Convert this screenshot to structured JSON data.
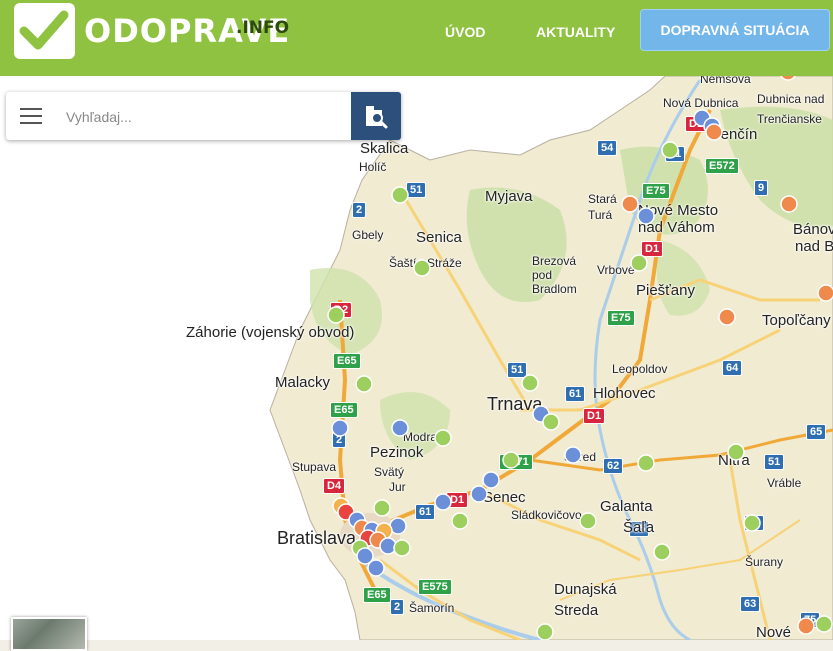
{
  "header": {
    "logo_text": "ODOPRAVE",
    "logo_suffix": ".INFO",
    "nav": [
      {
        "label": "ÚVOD"
      },
      {
        "label": "AKTUALITY"
      },
      {
        "label": "DOPRAVNÁ SITUÁCIA"
      }
    ]
  },
  "search": {
    "placeholder": "Vyhľadaj..."
  },
  "colors": {
    "brand_green": "#8fc241",
    "cta_blue": "#73b6ea",
    "search_button": "#2c4f7c",
    "marker_green": "#9ccf5e",
    "marker_blue": "#6b8fd8",
    "marker_orange": "#ef8a4c",
    "marker_red": "#e9433f",
    "marker_yellow": "#f3b24d"
  },
  "icons": {
    "logo": "check-icon",
    "menu": "hamburger-menu-icon",
    "search": "map-search-icon"
  },
  "map": {
    "places": [
      {
        "name": "Nemšová"
      },
      {
        "name": "Nová Dubnica"
      },
      {
        "name": "Dubnica nad"
      },
      {
        "name": "Trenčín"
      },
      {
        "name": "Trenčianske"
      },
      {
        "name": "Skalica"
      },
      {
        "name": "Holíč"
      },
      {
        "name": "Myjava"
      },
      {
        "name": "Stará"
      },
      {
        "name": "Turá"
      },
      {
        "name": "Nové Mesto"
      },
      {
        "name": "nad Váhom"
      },
      {
        "name": "Bánov"
      },
      {
        "name": "nad B"
      },
      {
        "name": "Senica"
      },
      {
        "name": "Gbely"
      },
      {
        "name": "Šaštín-Stráže"
      },
      {
        "name": "Brezová"
      },
      {
        "name": "pod"
      },
      {
        "name": "Bradlom"
      },
      {
        "name": "Vrbové"
      },
      {
        "name": "Piešťany"
      },
      {
        "name": "Topoľčany"
      },
      {
        "name": "Záhorie (vojenský obvod)"
      },
      {
        "name": "Leopoldov"
      },
      {
        "name": "Malacky"
      },
      {
        "name": "Trnava"
      },
      {
        "name": "Hlohovec"
      },
      {
        "name": "Modra"
      },
      {
        "name": "Pezinok"
      },
      {
        "name": "Sered"
      },
      {
        "name": "Nitra"
      },
      {
        "name": "Stupava"
      },
      {
        "name": "Svätý"
      },
      {
        "name": "Jur"
      },
      {
        "name": "Senec"
      },
      {
        "name": "Vráble"
      },
      {
        "name": "Galanta"
      },
      {
        "name": "Sládkovičovo"
      },
      {
        "name": "Šaľa"
      },
      {
        "name": "Bratislava"
      },
      {
        "name": "Šurany"
      },
      {
        "name": "Šamorín"
      },
      {
        "name": "Dunajská"
      },
      {
        "name": "Streda"
      },
      {
        "name": "Nové"
      }
    ],
    "road_shields": [
      {
        "label": "54"
      },
      {
        "label": "61"
      },
      {
        "label": "E572"
      },
      {
        "label": "9"
      },
      {
        "label": "51"
      },
      {
        "label": "E75"
      },
      {
        "label": "2"
      },
      {
        "label": "D1"
      },
      {
        "label": "D1"
      },
      {
        "label": "D2"
      },
      {
        "label": "E75"
      },
      {
        "label": "E65"
      },
      {
        "label": "E65"
      },
      {
        "label": "51"
      },
      {
        "label": "61"
      },
      {
        "label": "64"
      },
      {
        "label": "D1"
      },
      {
        "label": "2"
      },
      {
        "label": "E571"
      },
      {
        "label": "62"
      },
      {
        "label": "65"
      },
      {
        "label": "51"
      },
      {
        "label": "D4"
      },
      {
        "label": "D1"
      },
      {
        "label": "61"
      },
      {
        "label": "64"
      },
      {
        "label": "75"
      },
      {
        "label": "E575"
      },
      {
        "label": "E65"
      },
      {
        "label": "2"
      },
      {
        "label": "63"
      },
      {
        "label": "75"
      }
    ]
  }
}
